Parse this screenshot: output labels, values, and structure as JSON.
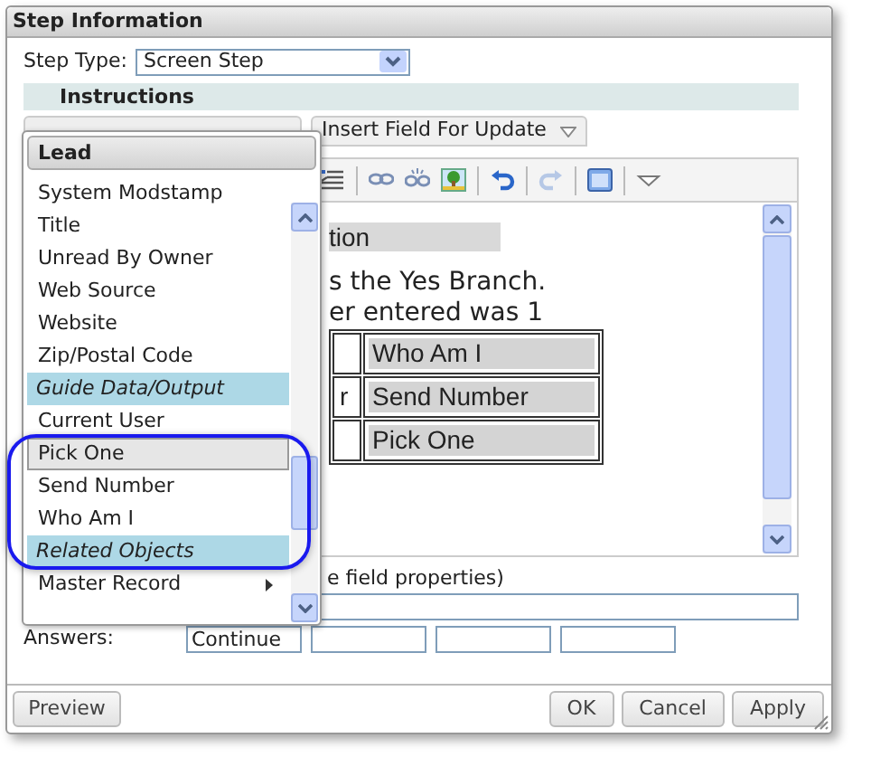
{
  "dialog": {
    "title": "Step Information"
  },
  "step_type": {
    "label": "Step Type:",
    "value": "Screen Step"
  },
  "section_header": "Instructions",
  "tabs": [
    {
      "label": "Insert Field For Update"
    }
  ],
  "toolbar": [
    {
      "kind": "indent",
      "disabled": false
    },
    {
      "kind": "separator"
    },
    {
      "kind": "link",
      "disabled": false
    },
    {
      "kind": "unlink",
      "disabled": false
    },
    {
      "kind": "image",
      "disabled": false
    },
    {
      "kind": "separator"
    },
    {
      "kind": "undo",
      "disabled": false
    },
    {
      "kind": "separator"
    },
    {
      "kind": "redo",
      "disabled": true
    },
    {
      "kind": "separator"
    },
    {
      "kind": "source",
      "disabled": false
    },
    {
      "kind": "separator"
    },
    {
      "kind": "more",
      "disabled": false
    }
  ],
  "editor": {
    "heading": "tion",
    "lines": [
      "s the Yes Branch.",
      "er entered was 1"
    ],
    "table": [
      {
        "column_2": "Who Am I"
      },
      {
        "column_1": "r",
        "column_2": "Send Number"
      },
      {
        "column_2": "Pick One"
      }
    ]
  },
  "help_text": "e field properties)",
  "answers": {
    "label": "Answers:",
    "fields": [
      {
        "kind": "filled",
        "value": "Continue"
      },
      {
        "kind": "blank"
      },
      {
        "kind": "blank"
      },
      {
        "kind": "blank"
      }
    ]
  },
  "buttons_left": [
    "Preview"
  ],
  "buttons_right": [
    "OK",
    "Cancel",
    "Apply"
  ],
  "dropdown": {
    "header": "Lead",
    "items": [
      {
        "kind": "item",
        "label": "System Modstamp",
        "selected": false
      },
      {
        "kind": "item",
        "label": "Title",
        "selected": false
      },
      {
        "kind": "item",
        "label": "Unread By Owner",
        "selected": false
      },
      {
        "kind": "item",
        "label": "Web Source",
        "selected": false
      },
      {
        "kind": "item",
        "label": "Website",
        "selected": false
      },
      {
        "kind": "item",
        "label": "Zip/Postal Code",
        "selected": false
      },
      {
        "kind": "section",
        "label": "Guide Data/Output"
      },
      {
        "kind": "item",
        "label": "Current User",
        "selected": false
      },
      {
        "kind": "item",
        "label": "Pick One",
        "selected": true
      },
      {
        "kind": "item",
        "label": "Send Number",
        "selected": false
      },
      {
        "kind": "item",
        "label": "Who Am I",
        "selected": false
      },
      {
        "kind": "section",
        "label": "Related Objects"
      },
      {
        "kind": "submenu",
        "label": "Master Record",
        "selected": false
      }
    ]
  }
}
